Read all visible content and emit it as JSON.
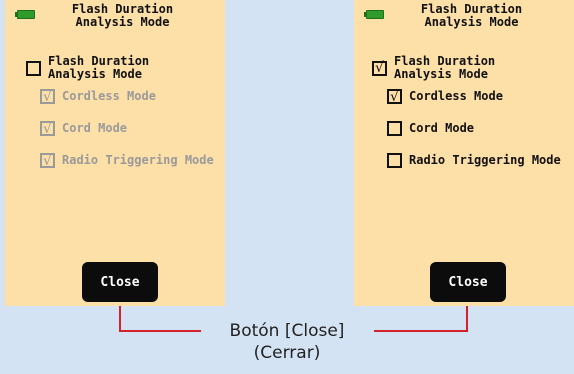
{
  "screens": [
    {
      "title": "Flash Duration\nAnalysis Mode",
      "main_option": {
        "label": "Flash Duration\nAnalysis Mode",
        "checked": false
      },
      "sub_options": [
        {
          "label": "Cordless Mode",
          "checked": true,
          "enabled": false
        },
        {
          "label": "Cord Mode",
          "checked": true,
          "enabled": false
        },
        {
          "label": "Radio Triggering Mode",
          "checked": true,
          "enabled": false
        }
      ],
      "close_label": "Close"
    },
    {
      "title": "Flash Duration\nAnalysis Mode",
      "main_option": {
        "label": "Flash Duration\nAnalysis Mode",
        "checked": true
      },
      "sub_options": [
        {
          "label": "Cordless Mode",
          "checked": true,
          "enabled": true
        },
        {
          "label": "Cord Mode",
          "checked": false,
          "enabled": true
        },
        {
          "label": "Radio Triggering Mode",
          "checked": false,
          "enabled": true
        }
      ],
      "close_label": "Close"
    }
  ],
  "caption": {
    "line1": "Botón [Close]",
    "line2": "(Cerrar)"
  },
  "colors": {
    "screen_bg": "#fddfa8",
    "page_bg": "#d3e3f3",
    "callout": "#d2232a",
    "button": "#0c0c0c"
  },
  "check_glyph": "√",
  "icons": {
    "battery": "battery-icon",
    "checkbox": "checkbox-icon"
  }
}
